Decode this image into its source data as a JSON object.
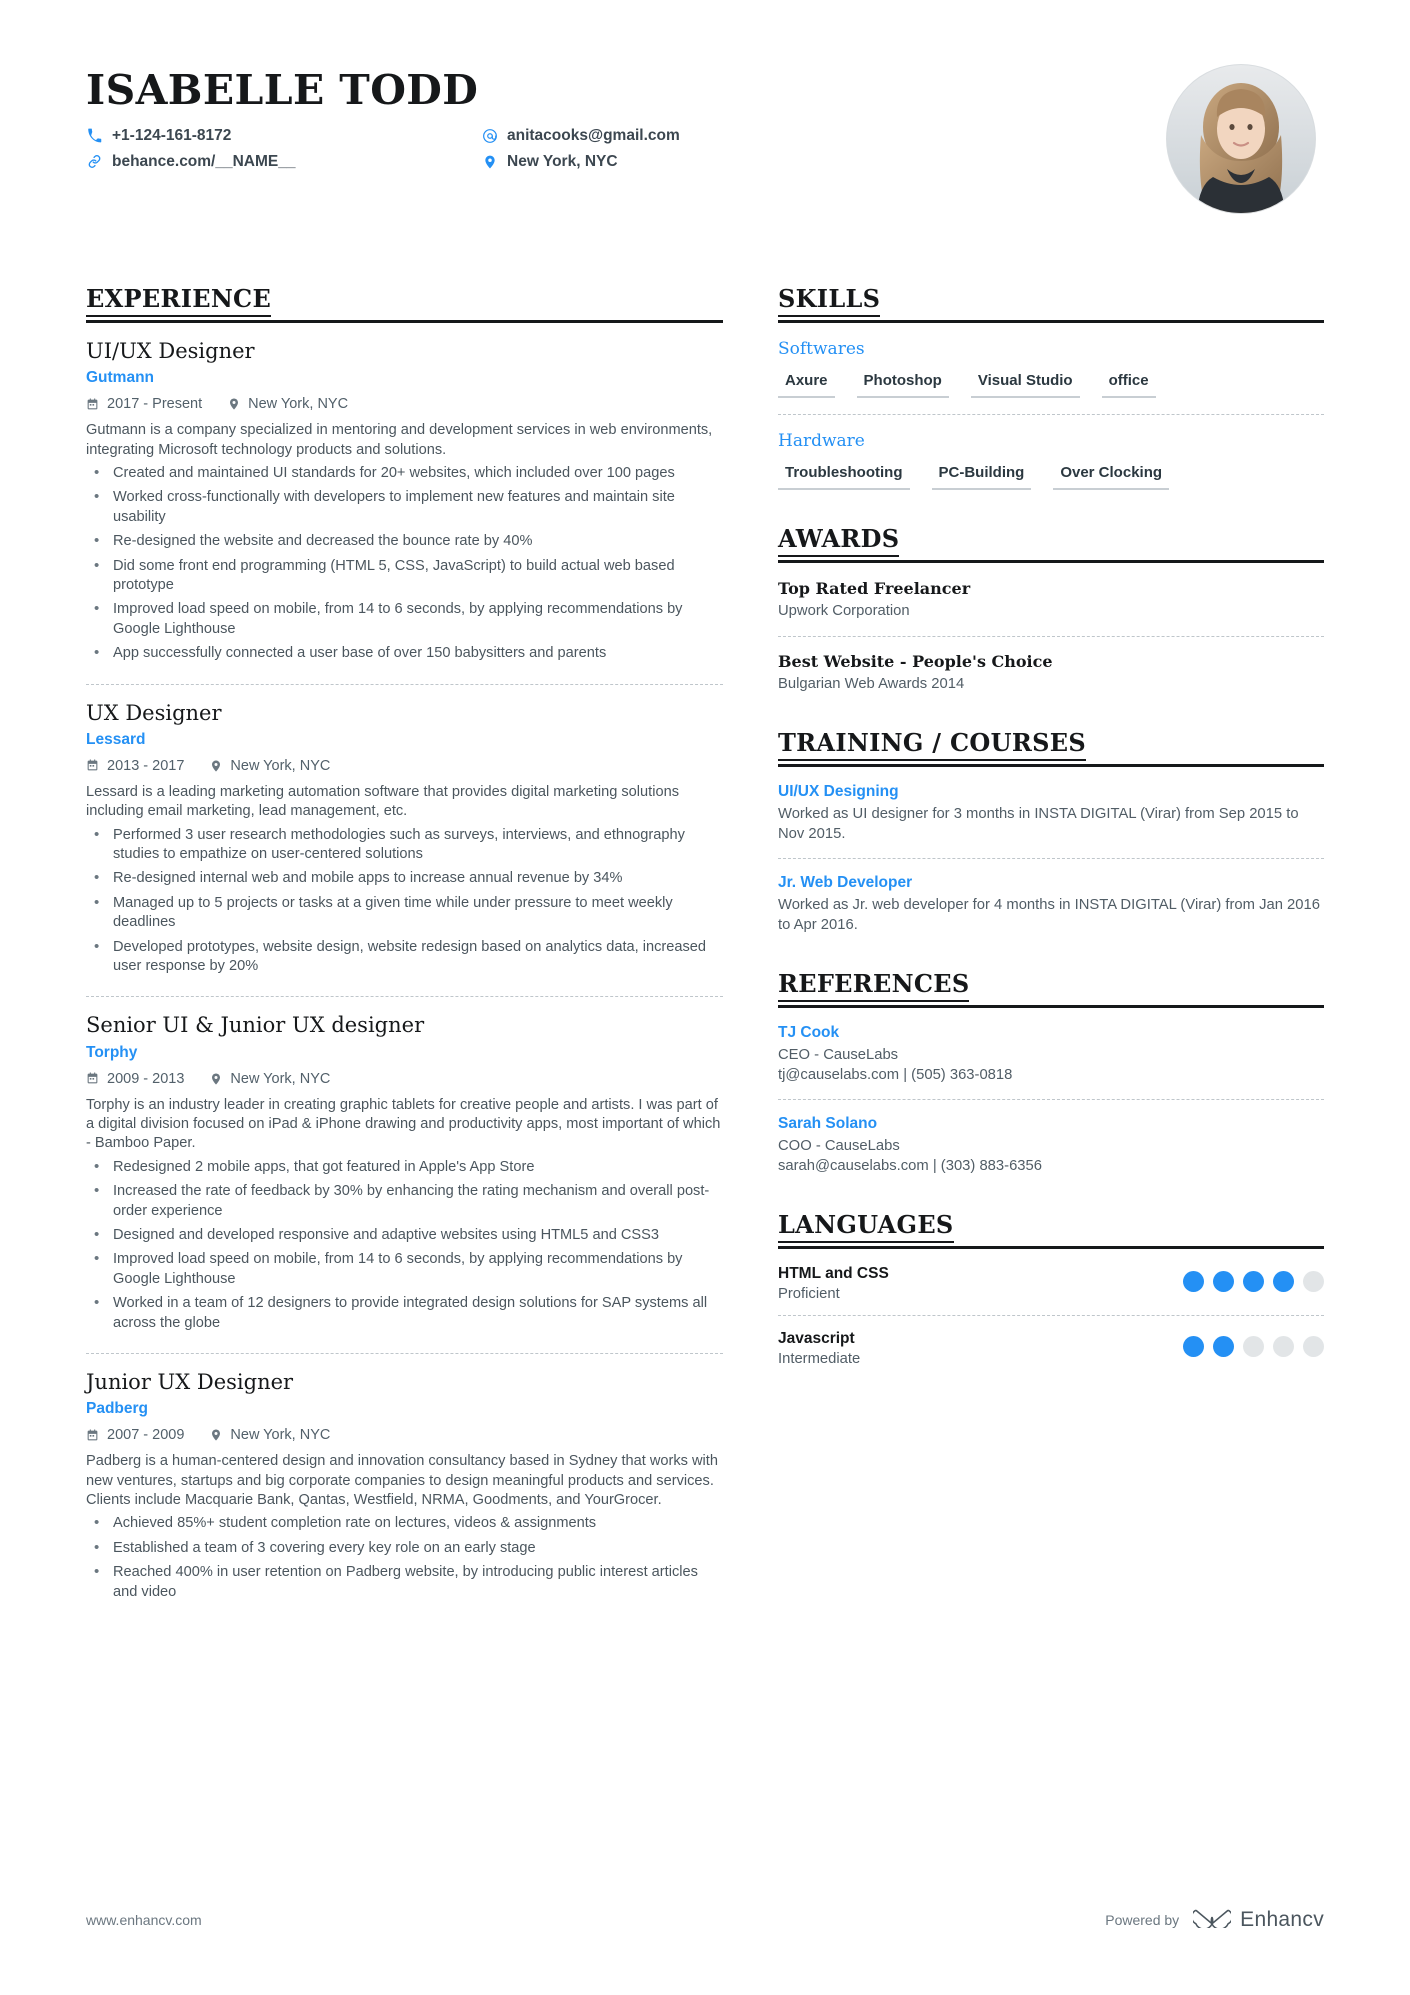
{
  "header": {
    "name": "ISABELLE TODD",
    "contacts_col1": [
      {
        "icon": "phone-icon",
        "text": "+1-124-161-8172"
      },
      {
        "icon": "link-icon",
        "text": "behance.com/__NAME__"
      }
    ],
    "contacts_col2": [
      {
        "icon": "email-icon",
        "text": "anitacooks@gmail.com"
      },
      {
        "icon": "location-icon",
        "text": "New York, NYC"
      }
    ]
  },
  "experience": {
    "title": "EXPERIENCE",
    "entries": [
      {
        "job_title": "UI/UX Designer",
        "company": "Gutmann",
        "dates": "2017 - Present",
        "location": "New York, NYC",
        "description": "Gutmann is a company specialized in mentoring and development services in web environments, integrating Microsoft technology products      and  solutions.",
        "bullets": [
          "Created and maintained UI standards for 20+ websites, which included over 100 pages",
          "Worked cross-functionally with developers to implement new features and maintain site usability",
          "Re-designed the website and decreased the bounce rate by 40%",
          "Did some front end programming (HTML 5, CSS, JavaScript) to build actual web based prototype",
          "Improved load speed on mobile, from 14 to 6 seconds, by applying recommendations by Google Lighthouse",
          "App successfully connected a user base of over 150 babysitters and parents"
        ]
      },
      {
        "job_title": "UX Designer",
        "company": "Lessard",
        "dates": "2013 - 2017",
        "location": "New York, NYC",
        "description": "Lessard is a leading marketing automation software that provides digital marketing solutions including email marketing, lead management, etc.",
        "bullets": [
          "Performed 3 user research methodologies such as surveys, interviews, and ethnography studies to empathize on user-centered solutions",
          "Re-designed internal web and mobile apps to increase annual revenue by 34%",
          "Managed up to 5 projects or tasks at a given time while under pressure to meet weekly deadlines",
          "Developed prototypes, website design, website redesign based on analytics data, increased user response by 20%"
        ]
      },
      {
        "job_title": "Senior UI & Junior UX designer",
        "company": "Torphy",
        "dates": "2009 - 2013",
        "location": "New York, NYC",
        "description": "Torphy is an industry leader in creating graphic tablets for creative people and artists. I was part of a digital division focused on iPad & iPhone drawing and productivity apps, most important of which - Bamboo Paper.",
        "bullets": [
          "Redesigned 2 mobile apps, that got featured in Apple's App Store",
          "Increased the rate of feedback by 30% by enhancing the rating mechanism and overall post-order experience",
          "Designed and developed responsive and adaptive websites using HTML5 and CSS3",
          "Improved load speed on mobile, from 14 to 6 seconds, by applying recommendations by Google Lighthouse",
          "Worked in a team of 12 designers to provide integrated design solutions for SAP systems all across the globe"
        ]
      },
      {
        "job_title": "Junior UX Designer",
        "company": "Padberg",
        "dates": "2007 - 2009",
        "location": "New York, NYC",
        "description": "Padberg is a human-centered design and innovation consultancy based in Sydney that works with new ventures, startups and big corporate companies to design meaningful products and services. Clients include Macquarie Bank, Qantas, Westfield, NRMA, Goodments, and YourGrocer.",
        "bullets": [
          "Achieved 85%+ student completion rate on lectures, videos & assignments",
          "Established a team of 3 covering every key role on an early stage",
          "Reached 400% in user retention on Padberg website, by introducing public interest articles and video"
        ]
      }
    ]
  },
  "skills": {
    "title": "SKILLS",
    "groups": [
      {
        "label": "Softwares",
        "tags": [
          "Axure",
          "Photoshop",
          "Visual Studio",
          "office"
        ]
      },
      {
        "label": "Hardware",
        "tags": [
          "Troubleshooting",
          "PC-Building",
          "Over Clocking"
        ]
      }
    ]
  },
  "awards": {
    "title": "AWARDS",
    "items": [
      {
        "name": "Top Rated Freelancer",
        "issuer": "Upwork Corporation"
      },
      {
        "name": "Best Website - People's Choice",
        "issuer": "Bulgarian Web Awards 2014"
      }
    ]
  },
  "training": {
    "title": "TRAINING / COURSES",
    "items": [
      {
        "name": "UI/UX Designing",
        "detail": "Worked as UI designer for 3 months in INSTA DIGITAL (Virar) from Sep 2015 to Nov 2015."
      },
      {
        "name": "Jr. Web Developer",
        "detail": "Worked as Jr. web developer for 4 months in INSTA DIGITAL (Virar) from Jan 2016 to Apr 2016."
      }
    ]
  },
  "references": {
    "title": "REFERENCES",
    "items": [
      {
        "name": "TJ Cook",
        "role": "CEO - CauseLabs",
        "contact": "tj@causelabs.com | (505) 363-0818"
      },
      {
        "name": "Sarah Solano",
        "role": "COO - CauseLabs",
        "contact": "sarah@causelabs.com | (303) 883-6356"
      }
    ]
  },
  "languages": {
    "title": "LANGUAGES",
    "items": [
      {
        "name": "HTML and CSS",
        "level": "Proficient",
        "filled": 4,
        "total": 5
      },
      {
        "name": "Javascript",
        "level": "Intermediate",
        "filled": 2,
        "total": 5
      }
    ]
  },
  "footer": {
    "url": "www.enhancv.com",
    "powered_by": "Powered by",
    "brand": "Enhancv"
  },
  "colors": {
    "accent": "#2490f4",
    "ink": "#16181a",
    "muted": "#4b565e"
  }
}
